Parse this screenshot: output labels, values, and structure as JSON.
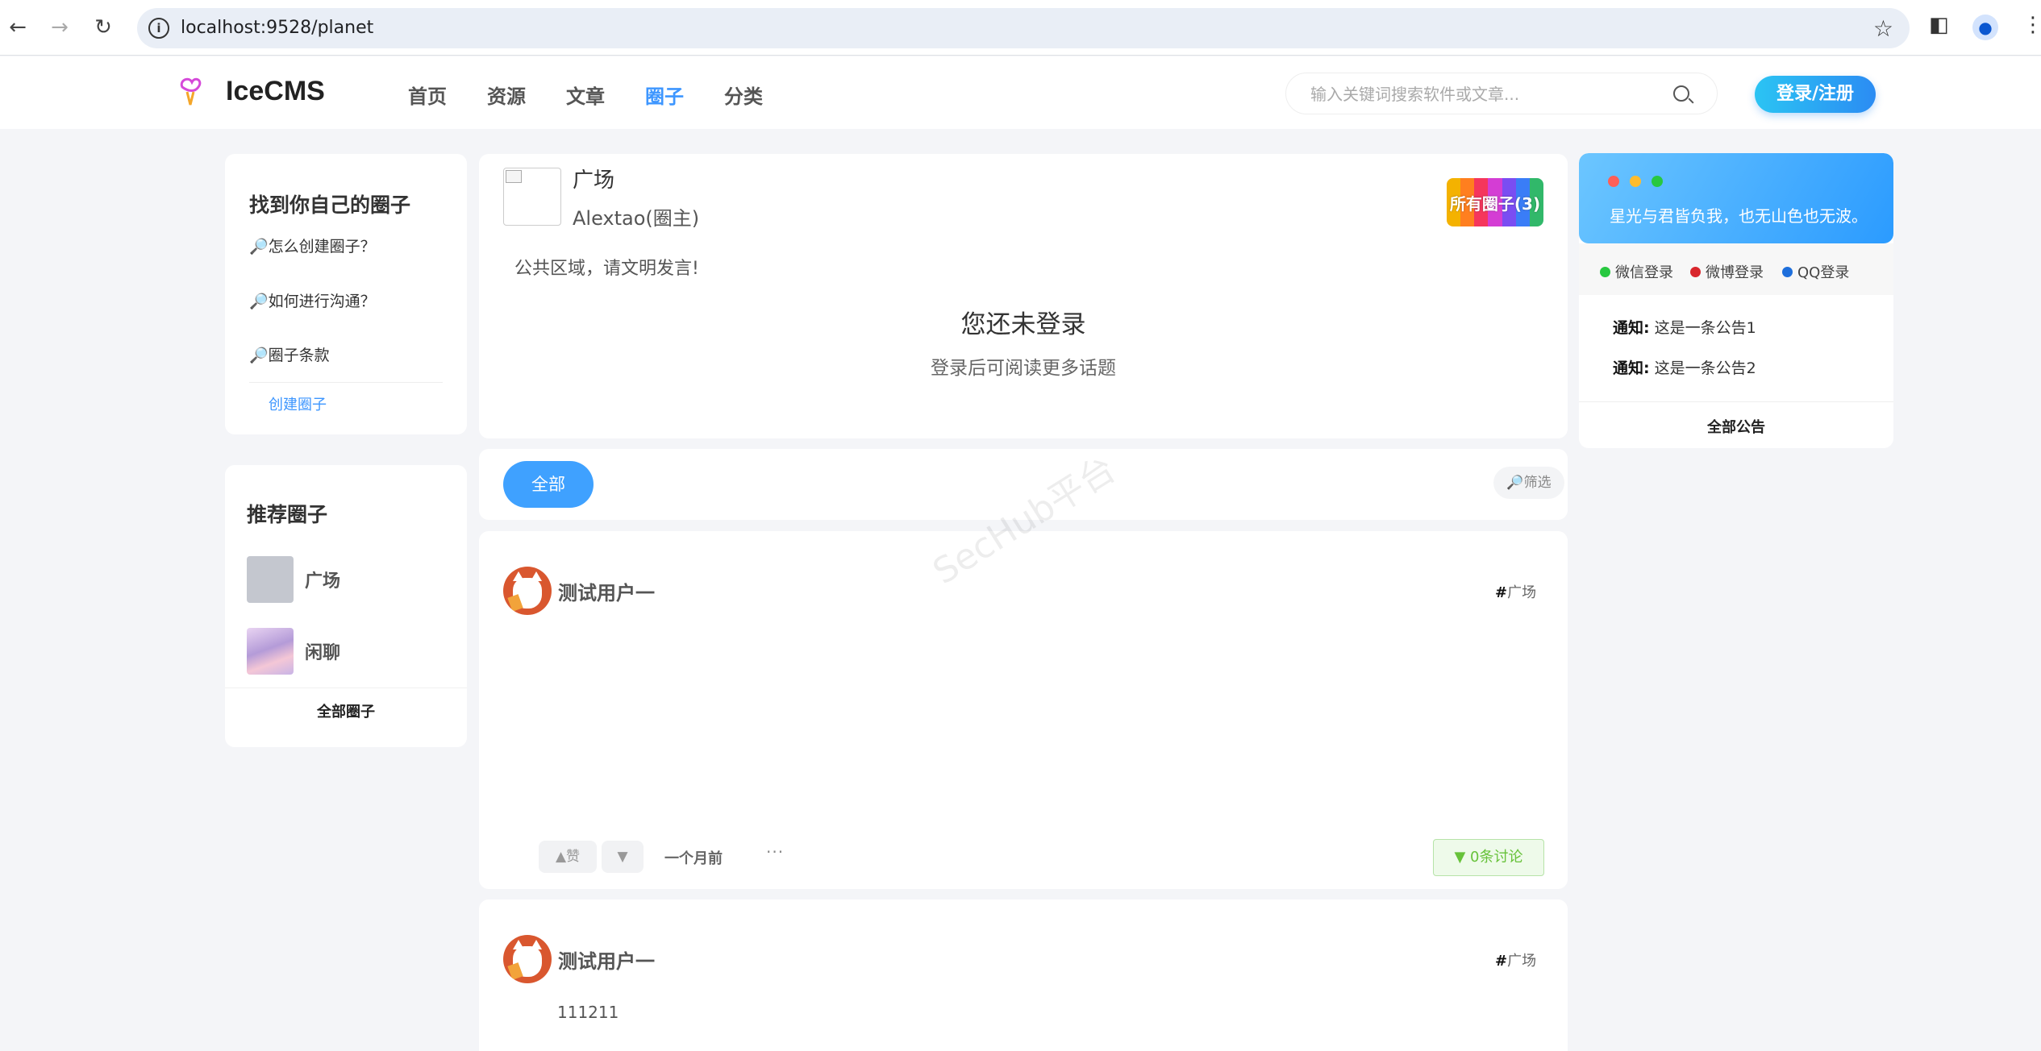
{
  "browser": {
    "url": "localhost:9528/planet",
    "back_icon": "←",
    "forward_icon": "→",
    "reload_icon": "↻",
    "info_icon": "i",
    "star_icon": "☆",
    "sidepanel_icon": "◧",
    "menu_icon": "⋮"
  },
  "header": {
    "logo": "IceCMS",
    "nav": [
      "首页",
      "资源",
      "文章",
      "圈子",
      "分类"
    ],
    "active_nav": "圈子",
    "search_placeholder": "输入关键词搜索软件或文章...",
    "login_label": "登录/注册",
    "accent": "#3d96ff"
  },
  "left": {
    "find": {
      "title": "找到你自己的圈子",
      "links": [
        "🔎怎么创建圈子？",
        "🔎如何进行沟通？",
        "🔎圈子条款"
      ],
      "create": "创建圈子"
    },
    "recommend": {
      "title": "推荐圈子",
      "items": [
        "广场",
        "闲聊"
      ],
      "all": "全部圈子"
    }
  },
  "circle": {
    "name": "广场",
    "owner": "Alextao(圈主)",
    "all_circles": "所有圈子(3)",
    "notice": "公共区域，请文明发言!",
    "not_logged": "您还未登录",
    "login_hint": "登录后可阅读更多话题"
  },
  "filter": {
    "all": "全部",
    "filter": "🔎筛选"
  },
  "posts": [
    {
      "user": "测试用户一",
      "tag_symbol": "#",
      "tag": "广场",
      "like": "▲赞",
      "dislike": "▼",
      "time": "一个月前",
      "more": "···",
      "discuss": "▼ 0条讨论"
    },
    {
      "user": "测试用户一",
      "tag_symbol": "#",
      "tag": "广场",
      "content": "111211"
    }
  ],
  "right": {
    "slogan": "星光与君皆负我，也无山色也无波。",
    "login_options": [
      "微信登录",
      "微博登录",
      "QQ登录"
    ],
    "notices": [
      {
        "label": "通知:",
        "text": "这是一条公告1"
      },
      {
        "label": "通知:",
        "text": "这是一条公告2"
      }
    ],
    "all": "全部公告"
  },
  "watermark": "SecHub平台"
}
